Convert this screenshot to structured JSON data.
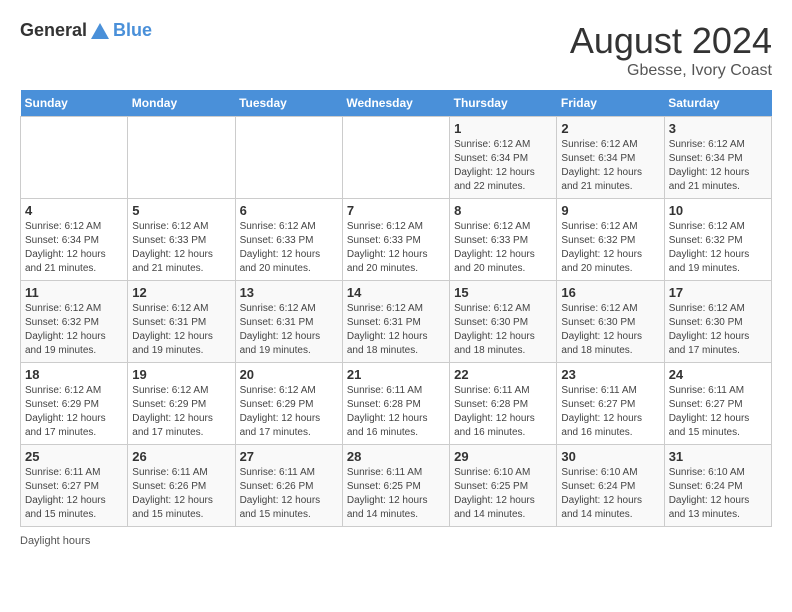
{
  "header": {
    "logo_general": "General",
    "logo_blue": "Blue",
    "title": "August 2024",
    "location": "Gbesse, Ivory Coast"
  },
  "days_of_week": [
    "Sunday",
    "Monday",
    "Tuesday",
    "Wednesday",
    "Thursday",
    "Friday",
    "Saturday"
  ],
  "weeks": [
    [
      {
        "day": "",
        "sunrise": "",
        "sunset": "",
        "daylight": ""
      },
      {
        "day": "",
        "sunrise": "",
        "sunset": "",
        "daylight": ""
      },
      {
        "day": "",
        "sunrise": "",
        "sunset": "",
        "daylight": ""
      },
      {
        "day": "",
        "sunrise": "",
        "sunset": "",
        "daylight": ""
      },
      {
        "day": "1",
        "sunrise": "Sunrise: 6:12 AM",
        "sunset": "Sunset: 6:34 PM",
        "daylight": "Daylight: 12 hours and 22 minutes."
      },
      {
        "day": "2",
        "sunrise": "Sunrise: 6:12 AM",
        "sunset": "Sunset: 6:34 PM",
        "daylight": "Daylight: 12 hours and 21 minutes."
      },
      {
        "day": "3",
        "sunrise": "Sunrise: 6:12 AM",
        "sunset": "Sunset: 6:34 PM",
        "daylight": "Daylight: 12 hours and 21 minutes."
      }
    ],
    [
      {
        "day": "4",
        "sunrise": "Sunrise: 6:12 AM",
        "sunset": "Sunset: 6:34 PM",
        "daylight": "Daylight: 12 hours and 21 minutes."
      },
      {
        "day": "5",
        "sunrise": "Sunrise: 6:12 AM",
        "sunset": "Sunset: 6:33 PM",
        "daylight": "Daylight: 12 hours and 21 minutes."
      },
      {
        "day": "6",
        "sunrise": "Sunrise: 6:12 AM",
        "sunset": "Sunset: 6:33 PM",
        "daylight": "Daylight: 12 hours and 20 minutes."
      },
      {
        "day": "7",
        "sunrise": "Sunrise: 6:12 AM",
        "sunset": "Sunset: 6:33 PM",
        "daylight": "Daylight: 12 hours and 20 minutes."
      },
      {
        "day": "8",
        "sunrise": "Sunrise: 6:12 AM",
        "sunset": "Sunset: 6:33 PM",
        "daylight": "Daylight: 12 hours and 20 minutes."
      },
      {
        "day": "9",
        "sunrise": "Sunrise: 6:12 AM",
        "sunset": "Sunset: 6:32 PM",
        "daylight": "Daylight: 12 hours and 20 minutes."
      },
      {
        "day": "10",
        "sunrise": "Sunrise: 6:12 AM",
        "sunset": "Sunset: 6:32 PM",
        "daylight": "Daylight: 12 hours and 19 minutes."
      }
    ],
    [
      {
        "day": "11",
        "sunrise": "Sunrise: 6:12 AM",
        "sunset": "Sunset: 6:32 PM",
        "daylight": "Daylight: 12 hours and 19 minutes."
      },
      {
        "day": "12",
        "sunrise": "Sunrise: 6:12 AM",
        "sunset": "Sunset: 6:31 PM",
        "daylight": "Daylight: 12 hours and 19 minutes."
      },
      {
        "day": "13",
        "sunrise": "Sunrise: 6:12 AM",
        "sunset": "Sunset: 6:31 PM",
        "daylight": "Daylight: 12 hours and 19 minutes."
      },
      {
        "day": "14",
        "sunrise": "Sunrise: 6:12 AM",
        "sunset": "Sunset: 6:31 PM",
        "daylight": "Daylight: 12 hours and 18 minutes."
      },
      {
        "day": "15",
        "sunrise": "Sunrise: 6:12 AM",
        "sunset": "Sunset: 6:30 PM",
        "daylight": "Daylight: 12 hours and 18 minutes."
      },
      {
        "day": "16",
        "sunrise": "Sunrise: 6:12 AM",
        "sunset": "Sunset: 6:30 PM",
        "daylight": "Daylight: 12 hours and 18 minutes."
      },
      {
        "day": "17",
        "sunrise": "Sunrise: 6:12 AM",
        "sunset": "Sunset: 6:30 PM",
        "daylight": "Daylight: 12 hours and 17 minutes."
      }
    ],
    [
      {
        "day": "18",
        "sunrise": "Sunrise: 6:12 AM",
        "sunset": "Sunset: 6:29 PM",
        "daylight": "Daylight: 12 hours and 17 minutes."
      },
      {
        "day": "19",
        "sunrise": "Sunrise: 6:12 AM",
        "sunset": "Sunset: 6:29 PM",
        "daylight": "Daylight: 12 hours and 17 minutes."
      },
      {
        "day": "20",
        "sunrise": "Sunrise: 6:12 AM",
        "sunset": "Sunset: 6:29 PM",
        "daylight": "Daylight: 12 hours and 17 minutes."
      },
      {
        "day": "21",
        "sunrise": "Sunrise: 6:11 AM",
        "sunset": "Sunset: 6:28 PM",
        "daylight": "Daylight: 12 hours and 16 minutes."
      },
      {
        "day": "22",
        "sunrise": "Sunrise: 6:11 AM",
        "sunset": "Sunset: 6:28 PM",
        "daylight": "Daylight: 12 hours and 16 minutes."
      },
      {
        "day": "23",
        "sunrise": "Sunrise: 6:11 AM",
        "sunset": "Sunset: 6:27 PM",
        "daylight": "Daylight: 12 hours and 16 minutes."
      },
      {
        "day": "24",
        "sunrise": "Sunrise: 6:11 AM",
        "sunset": "Sunset: 6:27 PM",
        "daylight": "Daylight: 12 hours and 15 minutes."
      }
    ],
    [
      {
        "day": "25",
        "sunrise": "Sunrise: 6:11 AM",
        "sunset": "Sunset: 6:27 PM",
        "daylight": "Daylight: 12 hours and 15 minutes."
      },
      {
        "day": "26",
        "sunrise": "Sunrise: 6:11 AM",
        "sunset": "Sunset: 6:26 PM",
        "daylight": "Daylight: 12 hours and 15 minutes."
      },
      {
        "day": "27",
        "sunrise": "Sunrise: 6:11 AM",
        "sunset": "Sunset: 6:26 PM",
        "daylight": "Daylight: 12 hours and 15 minutes."
      },
      {
        "day": "28",
        "sunrise": "Sunrise: 6:11 AM",
        "sunset": "Sunset: 6:25 PM",
        "daylight": "Daylight: 12 hours and 14 minutes."
      },
      {
        "day": "29",
        "sunrise": "Sunrise: 6:10 AM",
        "sunset": "Sunset: 6:25 PM",
        "daylight": "Daylight: 12 hours and 14 minutes."
      },
      {
        "day": "30",
        "sunrise": "Sunrise: 6:10 AM",
        "sunset": "Sunset: 6:24 PM",
        "daylight": "Daylight: 12 hours and 14 minutes."
      },
      {
        "day": "31",
        "sunrise": "Sunrise: 6:10 AM",
        "sunset": "Sunset: 6:24 PM",
        "daylight": "Daylight: 12 hours and 13 minutes."
      }
    ]
  ],
  "footer": {
    "daylight_label": "Daylight hours"
  }
}
